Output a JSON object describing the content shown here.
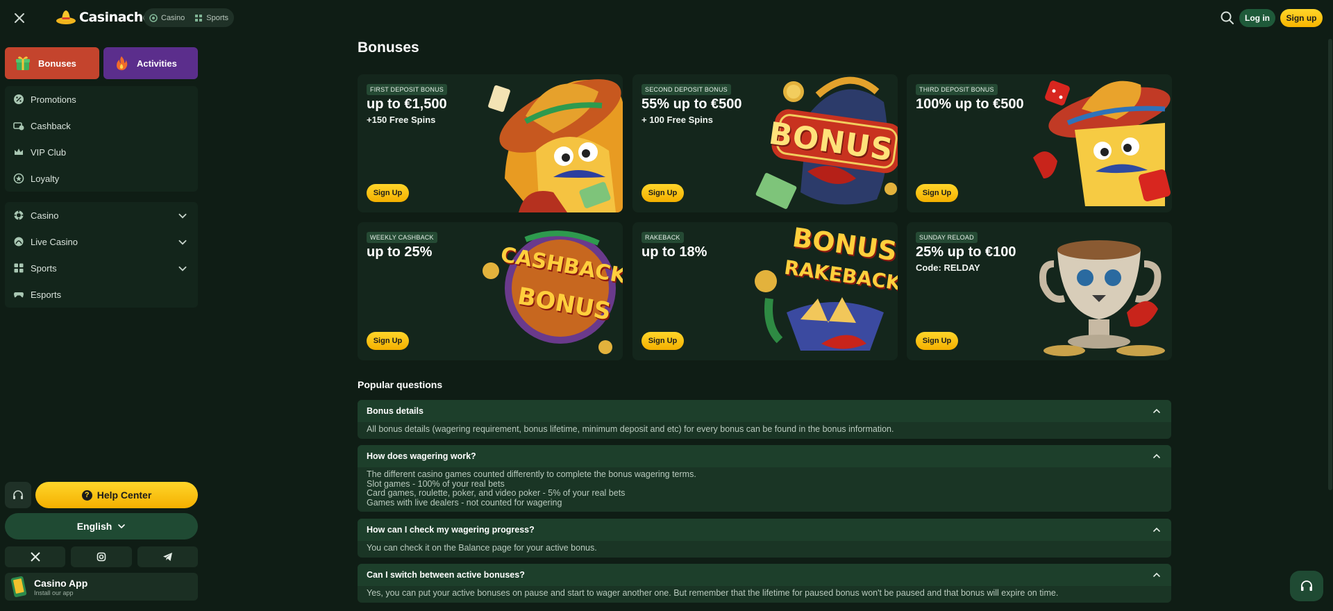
{
  "header": {
    "brand": "Casinacho",
    "switch": [
      {
        "label": "Casino"
      },
      {
        "label": "Sports"
      }
    ],
    "login_label": "Log in",
    "signup_label": "Sign up"
  },
  "sidebar": {
    "tabs": [
      {
        "label": "Bonuses"
      },
      {
        "label": "Activities"
      }
    ],
    "group1": [
      {
        "label": "Promotions",
        "icon": "percent-icon"
      },
      {
        "label": "Cashback",
        "icon": "cashback-icon"
      },
      {
        "label": "VIP Club",
        "icon": "crown-icon"
      },
      {
        "label": "Loyalty",
        "icon": "loyalty-icon"
      }
    ],
    "group2": [
      {
        "label": "Casino",
        "icon": "chip-icon",
        "expandable": true
      },
      {
        "label": "Live Casino",
        "icon": "live-icon",
        "expandable": true
      },
      {
        "label": "Sports",
        "icon": "sports-icon",
        "expandable": true
      },
      {
        "label": "Esports",
        "icon": "esports-icon",
        "expandable": false
      }
    ],
    "help_label": "Help Center",
    "language": "English",
    "app": {
      "title": "Casino App",
      "subtitle": "Install our app"
    }
  },
  "main": {
    "title": "Bonuses",
    "cards": [
      {
        "tag": "FIRST DEPOSIT BONUS",
        "title": "up to €1,500",
        "subtitle": "+150 Free Spins",
        "button": "Sign Up"
      },
      {
        "tag": "SECOND DEPOSIT BONUS",
        "title": "55% up to €500",
        "subtitle": "+ 100 Free Spins",
        "button": "Sign Up",
        "art_text": "BONUS"
      },
      {
        "tag": "THIRD DEPOSIT BONUS",
        "title": "100% up to €500",
        "subtitle": "",
        "button": "Sign Up"
      },
      {
        "tag": "WEEKLY CASHBACK",
        "title": "up to 25%",
        "subtitle": "",
        "button": "Sign Up",
        "art_text": [
          "CASHBACK",
          "BONUS"
        ]
      },
      {
        "tag": "RAKEBACK",
        "title": "up to 18%",
        "subtitle": "",
        "button": "Sign Up",
        "art_text": [
          "BONUS",
          "RAKEBACK"
        ]
      },
      {
        "tag": "SUNDAY RELOAD",
        "title": "25% up to €100",
        "subtitle": "Code: RELDAY",
        "button": "Sign Up"
      }
    ],
    "faq_heading": "Popular questions",
    "faq": [
      {
        "q": "Bonus details",
        "a": [
          "All bonus details (wagering requirement, bonus lifetime, minimum deposit and etc) for every bonus can be found in the bonus information."
        ]
      },
      {
        "q": "How does wagering work?",
        "a": [
          "The different casino games counted differently to complete the bonus wagering terms.",
          "Slot games - 100% of your real bets",
          "Card games, roulette, poker, and video poker - 5% of your real bets",
          "Games with live dealers - not counted for wagering"
        ]
      },
      {
        "q": "How can I check my wagering progress?",
        "a": [
          "You can check it on the Balance page for your active bonus."
        ]
      },
      {
        "q": "Can I switch between active bonuses?",
        "a": [
          "Yes, you can put your active bonuses on pause and start to wager another one. But remember that the lifetime for paused bonus won't be paused and that bonus will expire on time."
        ]
      }
    ]
  },
  "colors": {
    "accent": "#f7b500",
    "bg": "#0f1d15",
    "panel": "#13251b",
    "bonuses_tab": "#c4442d",
    "activities_tab": "#5b2e8c"
  }
}
